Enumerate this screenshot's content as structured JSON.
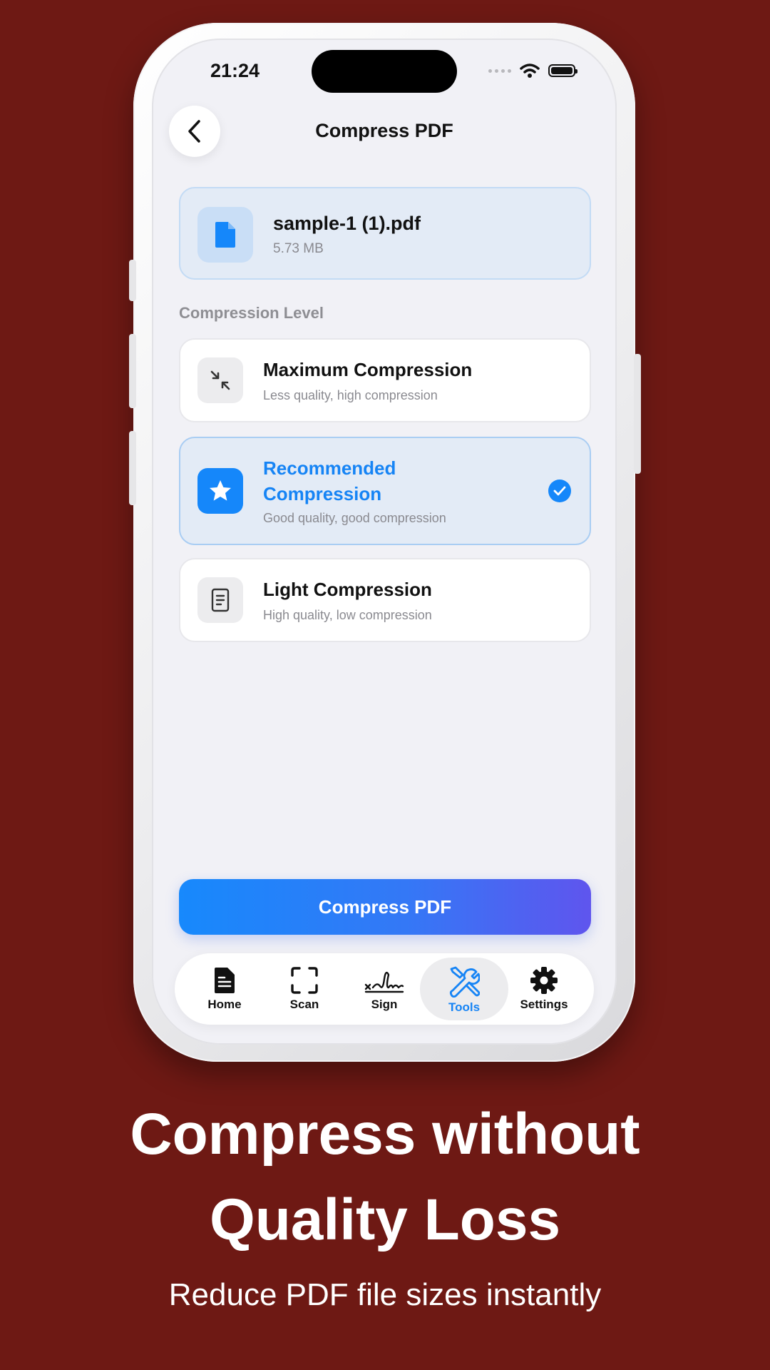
{
  "status_bar": {
    "time": "21:24"
  },
  "nav": {
    "title": "Compress PDF"
  },
  "file": {
    "name": "sample-1 (1).pdf",
    "size": "5.73 MB"
  },
  "section_label": "Compression Level",
  "options": [
    {
      "title": "Maximum Compression",
      "subtitle": "Less quality, high compression",
      "icon": "compress-arrows-icon",
      "selected": false
    },
    {
      "title": "Recommended Compression",
      "subtitle": "Good quality, good compression",
      "icon": "star-icon",
      "selected": true
    },
    {
      "title": "Light Compression",
      "subtitle": "High quality, low compression",
      "icon": "document-lines-icon",
      "selected": false
    }
  ],
  "primary_button": "Compress PDF",
  "tabs": [
    {
      "label": "Home",
      "icon": "document-icon",
      "active": false
    },
    {
      "label": "Scan",
      "icon": "scan-frame-icon",
      "active": false
    },
    {
      "label": "Sign",
      "icon": "signature-icon",
      "active": false
    },
    {
      "label": "Tools",
      "icon": "tools-icon",
      "active": true
    },
    {
      "label": "Settings",
      "icon": "gear-icon",
      "active": false
    }
  ],
  "marketing": {
    "headline_line1": "Compress without",
    "headline_line2": "Quality Loss",
    "subline": "Reduce PDF file sizes instantly"
  },
  "colors": {
    "background": "#6e1914",
    "accent": "#1587fa",
    "gradient_end": "#5f55ee",
    "screen": "#f1f1f6"
  }
}
